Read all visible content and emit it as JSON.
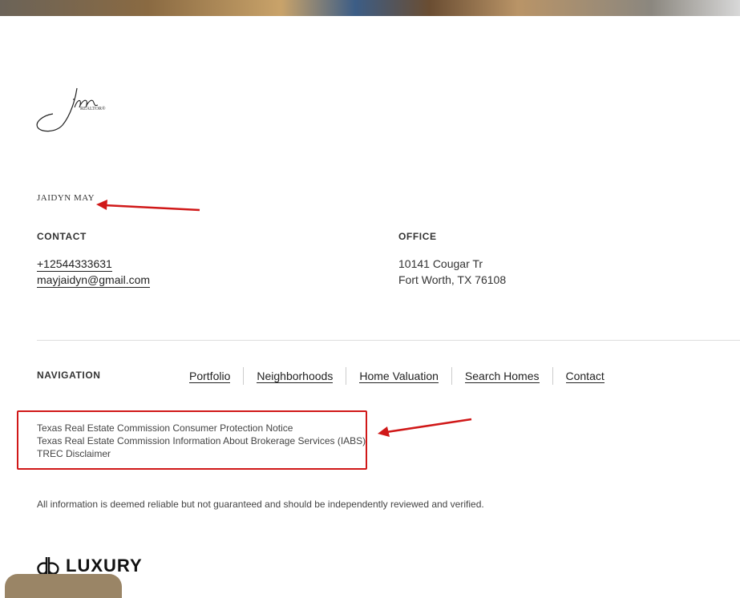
{
  "agent": {
    "name": "JAIDYN MAY",
    "logo_text": "REALTOR®"
  },
  "contact": {
    "label": "CONTACT",
    "phone": "+12544333631",
    "email": "mayjaidyn@gmail.com"
  },
  "office": {
    "label": "OFFICE",
    "address_line1": "10141 Cougar Tr",
    "address_line2": "Fort Worth, TX 76108"
  },
  "navigation": {
    "label": "NAVIGATION",
    "items": [
      {
        "label": "Portfolio"
      },
      {
        "label": "Neighborhoods"
      },
      {
        "label": "Home Valuation"
      },
      {
        "label": "Search Homes"
      },
      {
        "label": "Contact"
      }
    ]
  },
  "legal_links": [
    {
      "label": "Texas Real Estate Commission Consumer Protection Notice"
    },
    {
      "label": "Texas Real Estate Commission Information About Brokerage Services (IABS)"
    },
    {
      "label": "TREC Disclaimer"
    }
  ],
  "disclaimer": "All information is deemed reliable but not guaranteed and should be independently reviewed and verified.",
  "brand": {
    "luxury_text": "LUXURY"
  },
  "colors": {
    "annotation_red": "#d01818",
    "text": "#333333",
    "divider": "#dddddd"
  }
}
